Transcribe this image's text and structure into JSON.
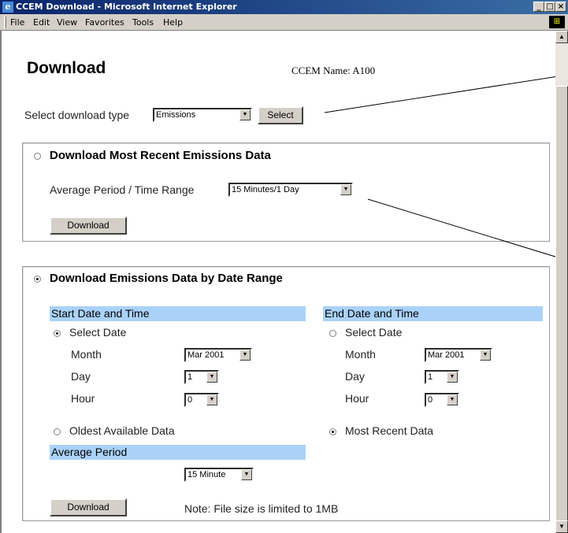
{
  "window": {
    "title": "CCEM Download - Microsoft Internet Explorer"
  },
  "menu": [
    "File",
    "Edit",
    "View",
    "Favorites",
    "Tools",
    "Help"
  ],
  "page": {
    "heading": "Download",
    "ccem_name": "CCEM Name: A100",
    "select_type_label": "Select download type",
    "select_type_value": "Emissions",
    "select_button": "Select"
  },
  "recent": {
    "title": "Download Most Recent Emissions Data",
    "period_label": "Average Period / Time Range",
    "period_value": "15 Minutes/1 Day",
    "download_button": "Download",
    "selected": false
  },
  "range": {
    "title": "Download Emissions Data by Date Range",
    "selected": true,
    "start": {
      "header": "Start Date and Time",
      "select_date": "Select Date",
      "select_date_selected": true,
      "month_label": "Month",
      "month_value": "Mar 2001",
      "day_label": "Day",
      "day_value": "1",
      "hour_label": "Hour",
      "hour_value": "0",
      "oldest": "Oldest Available Data",
      "oldest_selected": false
    },
    "end": {
      "header": "End Date and Time",
      "select_date": "Select Date",
      "select_date_selected": false,
      "month_label": "Month",
      "month_value": "Mar 2001",
      "day_label": "Day",
      "day_value": "1",
      "hour_label": "Hour",
      "hour_value": "0",
      "most_recent": "Most Recent Data",
      "most_recent_selected": true
    },
    "avg_header": "Average Period",
    "avg_value": "15 Minute",
    "download_button": "Download",
    "note": "Note: File size is limited to 1MB"
  }
}
